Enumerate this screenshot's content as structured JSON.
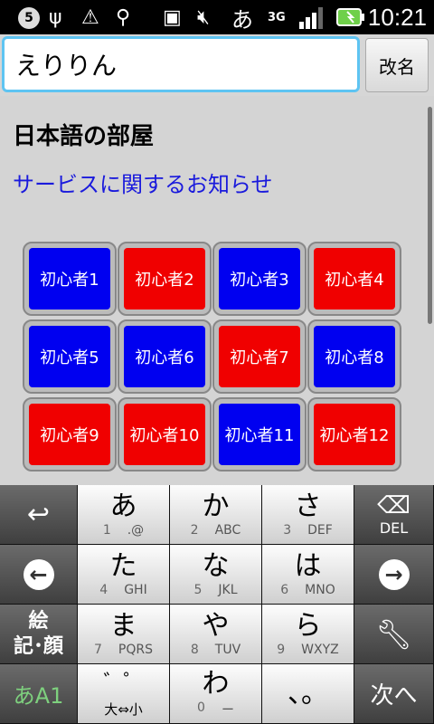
{
  "status_bar": {
    "notification_count": "5",
    "network": "3G",
    "input_mode": "あ",
    "time": "10:21"
  },
  "header": {
    "name_value": "えりりん",
    "rename_label": "改名"
  },
  "main": {
    "room_title": "日本語の部屋",
    "notice_link": "サービスに関するお知らせ",
    "rooms": [
      {
        "label": "初心者1",
        "color": "blue"
      },
      {
        "label": "初心者2",
        "color": "red"
      },
      {
        "label": "初心者3",
        "color": "blue"
      },
      {
        "label": "初心者4",
        "color": "red"
      },
      {
        "label": "初心者5",
        "color": "blue"
      },
      {
        "label": "初心者6",
        "color": "blue"
      },
      {
        "label": "初心者7",
        "color": "red"
      },
      {
        "label": "初心者8",
        "color": "blue"
      },
      {
        "label": "初心者9",
        "color": "red"
      },
      {
        "label": "初心者10",
        "color": "red"
      },
      {
        "label": "初心者11",
        "color": "blue"
      },
      {
        "label": "初心者12",
        "color": "red"
      }
    ]
  },
  "keyboard": {
    "del_label": "DEL",
    "emoji_label_1": "絵",
    "emoji_label_2": "記･顔",
    "mode_label": "あA1",
    "next_label": "次へ",
    "keys": [
      {
        "kana": "あ",
        "num": "1",
        "sub": ".@"
      },
      {
        "kana": "か",
        "num": "2",
        "sub": "ABC"
      },
      {
        "kana": "さ",
        "num": "3",
        "sub": "DEF"
      },
      {
        "kana": "た",
        "num": "4",
        "sub": "GHI"
      },
      {
        "kana": "な",
        "num": "5",
        "sub": "JKL"
      },
      {
        "kana": "は",
        "num": "6",
        "sub": "MNO"
      },
      {
        "kana": "ま",
        "num": "7",
        "sub": "PQRS"
      },
      {
        "kana": "や",
        "num": "8",
        "sub": "TUV"
      },
      {
        "kana": "ら",
        "num": "9",
        "sub": "WXYZ"
      },
      {
        "kana": "゛゜",
        "num": "",
        "sub": "大⇔小"
      },
      {
        "kana": "わ",
        "num": "0",
        "sub": "ー"
      },
      {
        "kana": "、。",
        "num": "",
        "sub": ""
      }
    ]
  },
  "colors": {
    "accent": "#5ec4f2",
    "room_blue": "#0000f0",
    "room_red": "#f00000",
    "link": "#1a1adc"
  }
}
